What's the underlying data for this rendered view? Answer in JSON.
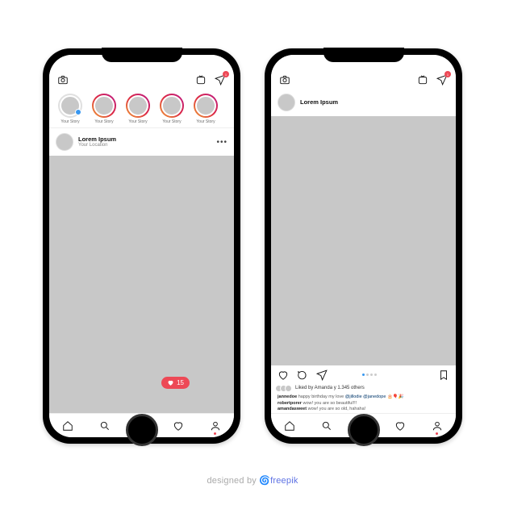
{
  "stories": [
    {
      "label": "Your Story",
      "own": true
    },
    {
      "label": "Your Story",
      "own": false
    },
    {
      "label": "Your Story",
      "own": false
    },
    {
      "label": "Your Story",
      "own": false
    },
    {
      "label": "Your Story",
      "own": false
    }
  ],
  "post1": {
    "username": "Lorem Ipsum",
    "location": "Your Location",
    "more": "•••",
    "like_bubble_count": "15",
    "dm_badge": "1"
  },
  "post2": {
    "username": "Lorem Ipsum",
    "dm_badge": "1",
    "likes_text": "Liked by Amanda y 1.345 others",
    "caption_user": "jannedoe",
    "caption_text": "happy birthday my love",
    "caption_tags": "@jillodie @janedope",
    "caption_emoji": " 🎂🎈🎉",
    "comment_user1": "robertporer",
    "comment_text1": "wow! you are so beautiful!!!",
    "comment_user2": "amandasweet",
    "comment_text2": "wow! you are so old, hahaha!"
  },
  "credit": {
    "prefix": "designed by ",
    "brand": "freepik"
  }
}
